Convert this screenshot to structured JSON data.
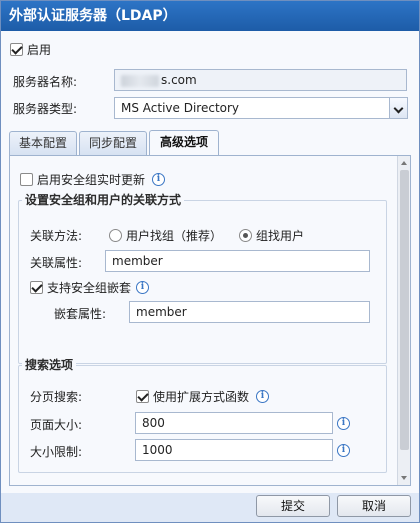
{
  "window": {
    "title": "外部认证服务器（LDAP）"
  },
  "enable": {
    "label": "启用",
    "checked": true
  },
  "server": {
    "name_label": "服务器名称:",
    "name_value_visible": "s.com",
    "type_label": "服务器类型:",
    "type_value": "MS Active Directory"
  },
  "tabs": [
    {
      "label": "基本配置",
      "active": false
    },
    {
      "label": "同步配置",
      "active": false
    },
    {
      "label": "高级选项",
      "active": true
    }
  ],
  "advanced": {
    "realtime_update_label": "启用安全组实时更新",
    "realtime_update_checked": false,
    "group_assoc_title": "设置安全组和用户的关联方式",
    "assoc_method_label": "关联方法:",
    "radio_user_find_group": "用户找组（推荐）",
    "radio_group_find_user": "组找用户",
    "selected_method": "组找用户",
    "assoc_attr_label": "关联属性:",
    "assoc_attr_value": "member",
    "nested_label": "支持安全组嵌套",
    "nested_checked": true,
    "nested_attr_label": "嵌套属性:",
    "nested_attr_value": "member",
    "search_title": "搜索选项",
    "paging_label": "分页搜索:",
    "paging_option_label": "使用扩展方式函数",
    "paging_checked": true,
    "page_size_label": "页面大小:",
    "page_size_value": "800",
    "size_limit_label": "大小限制:",
    "size_limit_value": "1000"
  },
  "footer": {
    "submit_label": "提交",
    "cancel_label": "取消"
  }
}
